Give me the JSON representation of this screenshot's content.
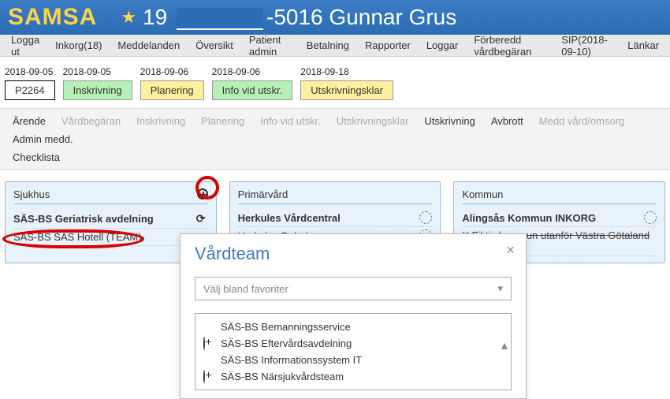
{
  "header": {
    "brand": "SAMSA",
    "id_prefix": "19",
    "id_suffix": "-5016 Gunnar Grus"
  },
  "menu": {
    "logout": "Logga ut",
    "inbox": "Inkorg(18)",
    "messages": "Meddelanden",
    "overview": "Översikt",
    "patient_admin": "Patient admin",
    "payment": "Betalning",
    "reports": "Rapporter",
    "logs": "Loggar",
    "prepare": "Förberedd vårdbegäran",
    "sip": "SIP(2018-09-10)",
    "links": "Länkar"
  },
  "timeline": [
    {
      "date": "2018-09-05",
      "label": "P2264",
      "style": "first"
    },
    {
      "date": "2018-09-05",
      "label": "Inskrivning",
      "style": "green"
    },
    {
      "date": "2018-09-06",
      "label": "Planering",
      "style": "yellow"
    },
    {
      "date": "2018-09-06",
      "label": "Info vid utskr.",
      "style": "green"
    },
    {
      "date": "2018-09-18",
      "label": "Utskrivningsklar",
      "style": "yellow"
    }
  ],
  "tabs": {
    "arende": "Ärende",
    "vardbegaran": "Vårdbegäran",
    "inskrivning": "Inskrivning",
    "planering": "Planering",
    "info": "Info vid utskr.",
    "utskrivningsklar": "Utskrivningsklar",
    "utskrivning": "Utskrivning",
    "avbrott": "Avbrott",
    "medd_vard": "Medd vård/omsorg",
    "admin_medd": "Admin medd.",
    "checklista": "Checklista"
  },
  "cards": {
    "sjukhus": {
      "title": "Sjukhus",
      "lines": [
        {
          "text": "SÄS-BS Geriatrisk avdelning",
          "strong": true,
          "icon": "refresh"
        },
        {
          "text": "SÄS-BS SÄS Hotell (TEAM)"
        }
      ]
    },
    "primarvard": {
      "title": "Primärvård",
      "lines": [
        {
          "text": "Herkules Vårdcentral",
          "strong": true,
          "icon": "chain"
        },
        {
          "text": "Herkules Rehab",
          "icon": "chain"
        }
      ]
    },
    "kommun": {
      "title": "Kommun",
      "lines": [
        {
          "text": "Alingsås Kommun INKORG",
          "strong": true,
          "icon": "chain"
        },
        {
          "text": "X Fiktiv kommun utanför Västra Götaland INKORG",
          "strike": true
        }
      ]
    }
  },
  "modal": {
    "title": "Vårdteam",
    "select_placeholder": "Välj bland favoriter",
    "options": [
      {
        "label": "SÄS-BS Bemanningsservice",
        "plus": false
      },
      {
        "label": "SÄS-BS Eftervårdsavdelning",
        "plus": true
      },
      {
        "label": "SÄS-BS Informationssystem IT",
        "plus": false
      },
      {
        "label": "SÄS-BS Närsjukvårdsteam",
        "plus": true
      }
    ]
  }
}
